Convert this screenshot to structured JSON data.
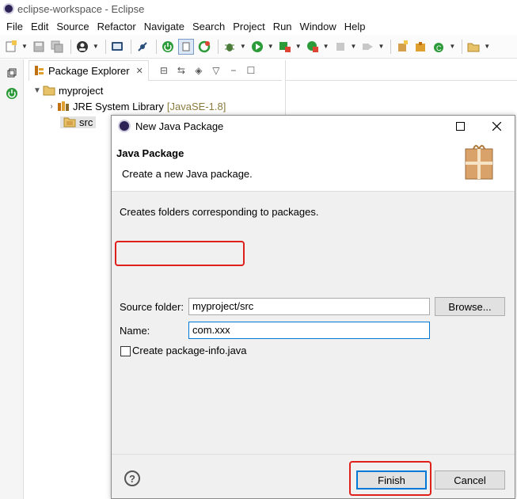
{
  "window": {
    "title": "eclipse-workspace - Eclipse"
  },
  "menubar": {
    "items": [
      "File",
      "Edit",
      "Source",
      "Refactor",
      "Navigate",
      "Search",
      "Project",
      "Run",
      "Window",
      "Help"
    ]
  },
  "package_explorer": {
    "tab_label": "Package Explorer",
    "tab_close": "✕",
    "tree": {
      "project": "myproject",
      "jre_label": "JRE System Library",
      "jre_version": "[JavaSE-1.8]",
      "src": "src"
    }
  },
  "dialog": {
    "title": "New Java Package",
    "header_title": "Java Package",
    "header_desc": "Create a new Java package.",
    "body_desc": "Creates folders corresponding to packages.",
    "source_folder_label": "Source folder:",
    "source_folder_value": "myproject/src",
    "browse_label": "Browse...",
    "name_label": "Name:",
    "name_value": "com.xxx",
    "checkbox_label": "Create package-info.java",
    "finish_label": "Finish",
    "cancel_label": "Cancel",
    "help_label": "?"
  },
  "colors": {
    "accent": "#0078d7",
    "highlight": "#e0201b"
  }
}
